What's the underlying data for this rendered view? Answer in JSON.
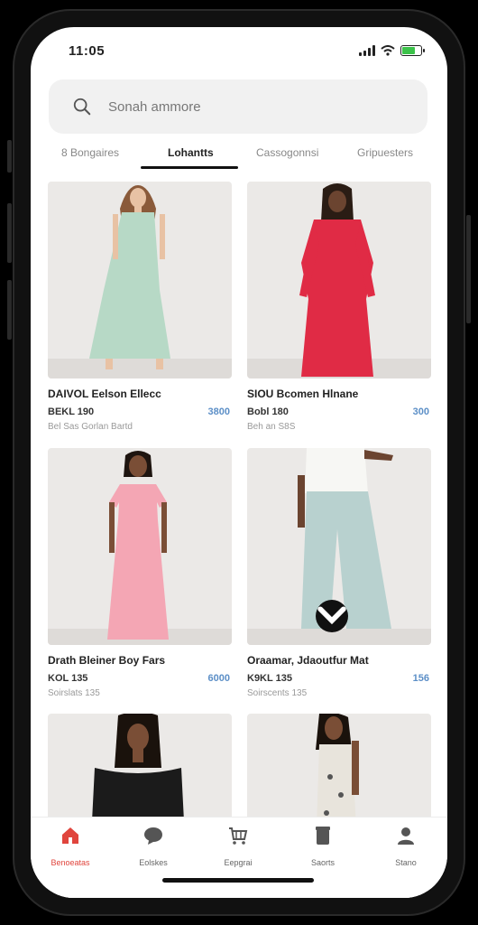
{
  "status_bar": {
    "time": "11:05",
    "battery_level": 0.7
  },
  "search": {
    "placeholder": "Sonah ammore"
  },
  "tabs": [
    {
      "label": "8 Bongaires"
    },
    {
      "label": "Lohantts",
      "active": true
    },
    {
      "label": "Cassogonnsi"
    },
    {
      "label": "Gripuesters"
    }
  ],
  "products": [
    {
      "title": "DAIVOL Eelson Ellecc",
      "price": "BEKL 190",
      "alt_price": "3800",
      "sub": "Bel Sas Gorlan Bartd",
      "dress_color": "#b7d9c6"
    },
    {
      "title": "SIOU Bcomen Hlnane",
      "price": "Bobl 180",
      "alt_price": "300",
      "sub": "Beh an S8S",
      "dress_color": "#e02b45"
    },
    {
      "title": "Drath Bleiner Boy Fars",
      "price": "KOL 135",
      "alt_price": "6000",
      "sub": "Soirslats 135",
      "dress_color": "#f4a6b4"
    },
    {
      "title": "Oraamar, Jdaoutfur Mat",
      "price": "K9KL 135",
      "alt_price": "156",
      "sub": "Soirscents 135",
      "dress_color": "#b8d1cf"
    },
    {
      "title": "",
      "price": "",
      "alt_price": "",
      "sub": "",
      "dress_color": "#1b1b1b"
    },
    {
      "title": "",
      "price": "",
      "alt_price": "",
      "sub": "",
      "dress_color": "#e8e4dc"
    }
  ],
  "bottom_nav": [
    {
      "label": "Benoeatas",
      "icon": "home-icon",
      "active": true
    },
    {
      "label": "Eolskes",
      "icon": "chat-bubble-icon"
    },
    {
      "label": "Eepgrai",
      "icon": "cart-icon"
    },
    {
      "label": "Saorts",
      "icon": "bag-icon"
    },
    {
      "label": "Stano",
      "icon": "profile-icon"
    }
  ],
  "colors": {
    "accent": "#e0453d",
    "price_alt": "#5c8fc7"
  }
}
